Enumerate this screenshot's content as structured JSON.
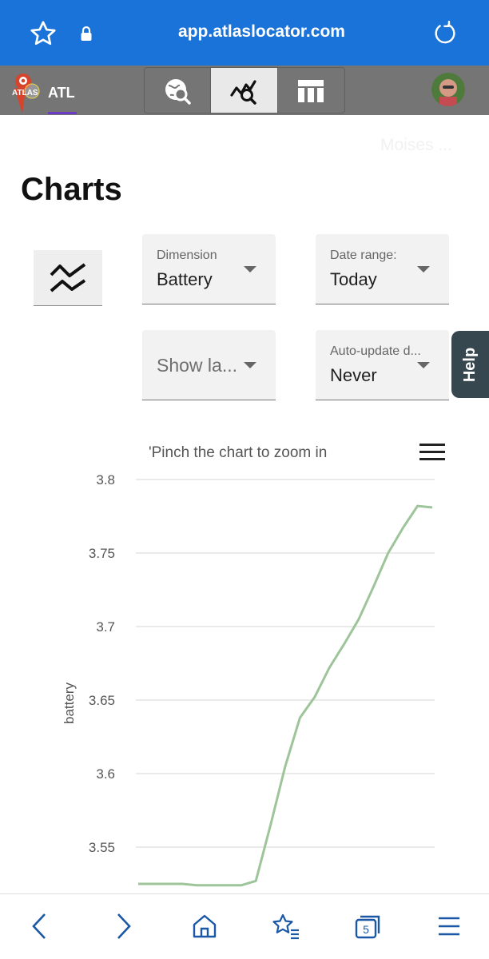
{
  "browser": {
    "url": "app.atlaslocator.com",
    "tab_count": "5"
  },
  "app": {
    "logo_text": "ATLAS",
    "brand_label": "ATL",
    "user_name_faded": "Moises ..."
  },
  "page": {
    "title": "Charts"
  },
  "filters": {
    "dimension": {
      "label": "Dimension",
      "value": "Battery"
    },
    "date_range": {
      "label": "Date range:",
      "value": "Today"
    },
    "show_labels": {
      "placeholder": "Show la..."
    },
    "auto_update": {
      "label": "Auto-update d...",
      "value": "Never"
    }
  },
  "help": {
    "label": "Help"
  },
  "colors": {
    "browser_bar": "#1a73d9",
    "app_header": "#757575",
    "line": "#9ec49a",
    "help_tab": "#37474f"
  },
  "chart_data": {
    "type": "line",
    "subtitle": "'Pinch the chart to zoom in",
    "ylabel": "battery",
    "xlabel": "",
    "yticks": [
      "3.8",
      "3.75",
      "3.7",
      "3.65",
      "3.6",
      "3.55"
    ],
    "ylim": [
      3.52,
      3.8
    ],
    "grid": true,
    "series": [
      {
        "values": [
          3.525,
          3.525,
          3.525,
          3.525,
          3.524,
          3.524,
          3.524,
          3.524,
          3.527,
          3.565,
          3.605,
          3.638,
          3.652,
          3.672,
          3.688,
          3.705,
          3.727,
          3.75,
          3.767,
          3.782,
          3.781
        ]
      }
    ]
  }
}
